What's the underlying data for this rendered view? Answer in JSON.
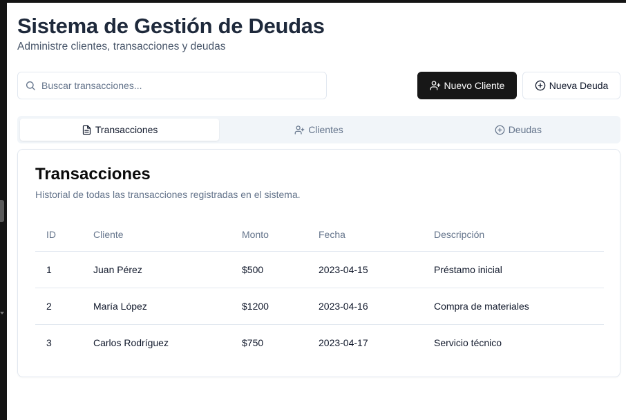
{
  "header": {
    "title": "Sistema de Gestión de Deudas",
    "subtitle": "Administre clientes, transacciones y deudas"
  },
  "search": {
    "placeholder": "Buscar transacciones...",
    "value": ""
  },
  "actions": {
    "new_client_label": "Nuevo Cliente",
    "new_debt_label": "Nueva Deuda"
  },
  "tabs": [
    {
      "label": "Transacciones",
      "icon": "file-text-icon",
      "active": true
    },
    {
      "label": "Clientes",
      "icon": "user-plus-icon",
      "active": false
    },
    {
      "label": "Deudas",
      "icon": "plus-circle-icon",
      "active": false
    }
  ],
  "card": {
    "title": "Transacciones",
    "description": "Historial de todas las transacciones registradas en el sistema."
  },
  "table": {
    "headers": [
      "ID",
      "Cliente",
      "Monto",
      "Fecha",
      "Descripción"
    ],
    "rows": [
      [
        "1",
        "Juan Pérez",
        "$500",
        "2023-04-15",
        "Préstamo inicial"
      ],
      [
        "2",
        "María López",
        "$1200",
        "2023-04-16",
        "Compra de materiales"
      ],
      [
        "3",
        "Carlos Rodríguez",
        "$750",
        "2023-04-17",
        "Servicio técnico"
      ]
    ]
  },
  "colors": {
    "primary_button": "#171717",
    "tabs_background": "#f1f5f9",
    "muted_text": "#64748b",
    "border": "#e2e8f0"
  }
}
